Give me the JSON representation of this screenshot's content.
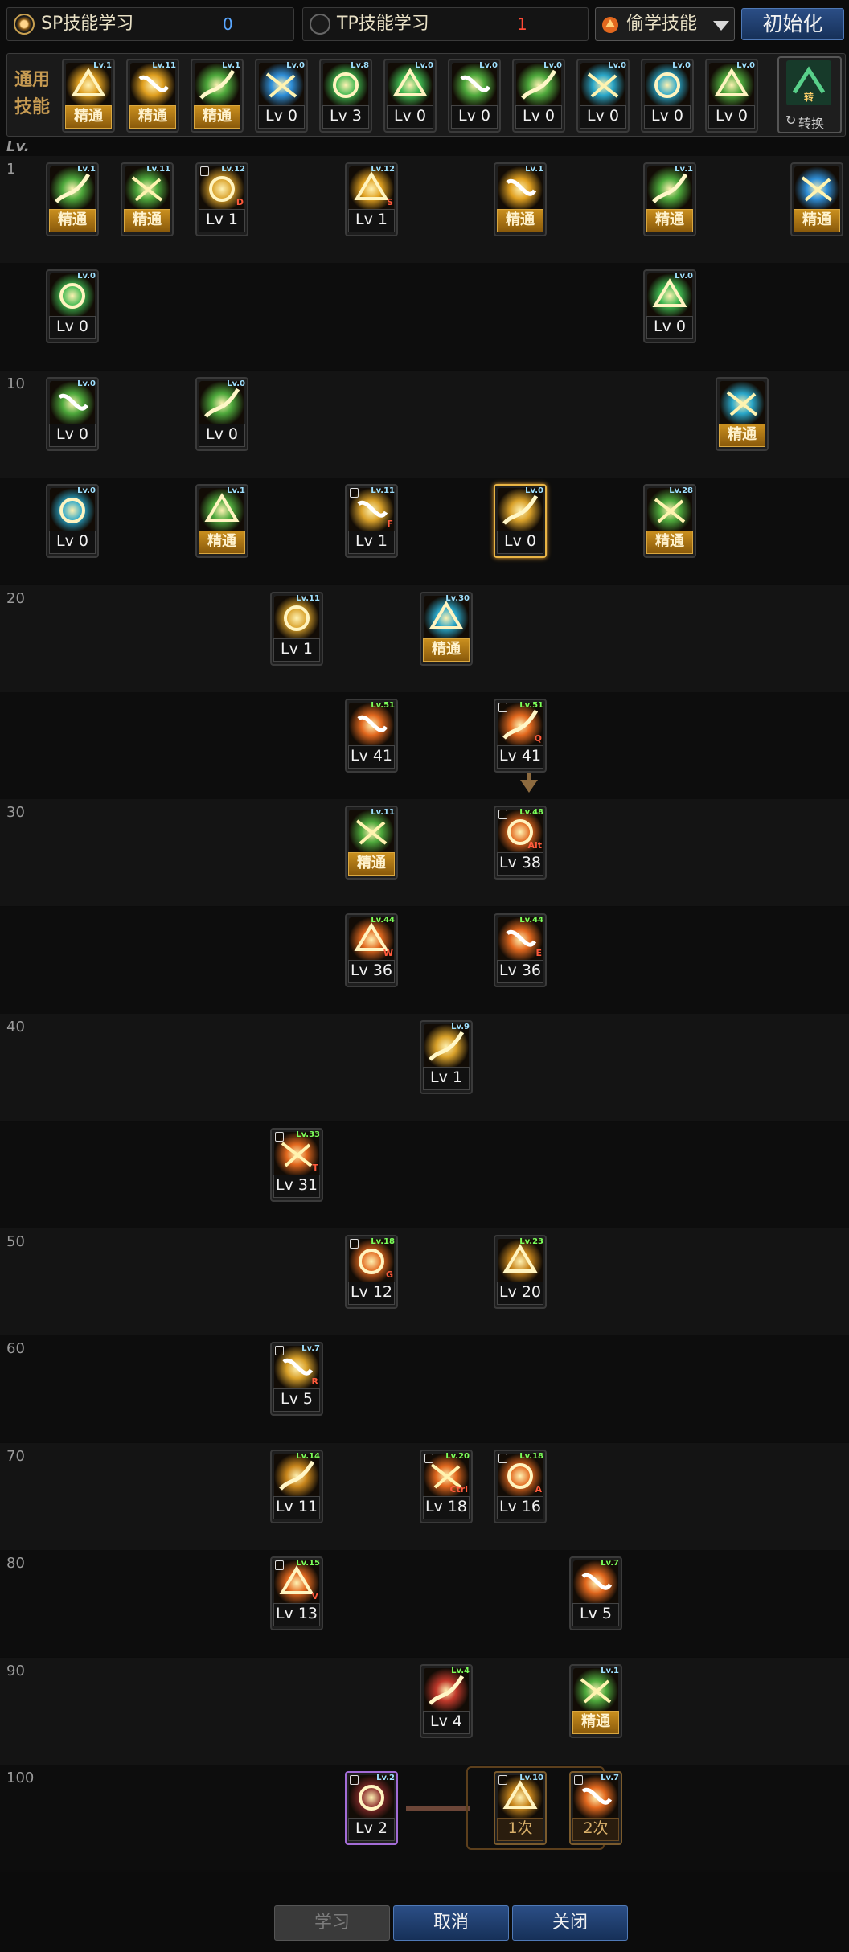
{
  "topbar": {
    "sp_label": "SP技能学习",
    "sp_value": "0",
    "tp_label": "TP技能学习",
    "tp_value": "1",
    "steal_label": "偷学技能",
    "init_label": "初始化"
  },
  "general": {
    "label_line1": "通用",
    "label_line2": "技能",
    "switch_label": "转换",
    "items": [
      {
        "badge": "Lv.1",
        "caption": "精通",
        "master": true,
        "color": "#e0a020"
      },
      {
        "badge": "Lv.11",
        "caption": "精通",
        "master": true,
        "color": "#e0a020"
      },
      {
        "badge": "Lv.1",
        "caption": "精通",
        "master": true,
        "color": "#4ea93c"
      },
      {
        "badge": "Lv.0",
        "caption": "Lv 0",
        "master": false,
        "color": "#2f8fd8"
      },
      {
        "badge": "Lv.8",
        "caption": "Lv 3",
        "master": false,
        "color": "#3fb950"
      },
      {
        "badge": "Lv.0",
        "caption": "Lv 0",
        "master": false,
        "color": "#3fb950"
      },
      {
        "badge": "Lv.0",
        "caption": "Lv 0",
        "master": false,
        "color": "#4ea93c"
      },
      {
        "badge": "Lv.0",
        "caption": "Lv 0",
        "master": false,
        "color": "#4ea93c"
      },
      {
        "badge": "Lv.0",
        "caption": "Lv 0",
        "master": false,
        "color": "#2aa7c9"
      },
      {
        "badge": "Lv.0",
        "caption": "Lv 0",
        "master": false,
        "color": "#2aa7c9"
      },
      {
        "badge": "Lv.0",
        "caption": "Lv 0",
        "master": false,
        "color": "#4ea93c"
      }
    ]
  },
  "lv_header": "Lv.",
  "row_labels": [
    "1",
    "",
    "10",
    "",
    "20",
    "",
    "30",
    "",
    "40",
    "",
    "50",
    "60",
    "70",
    "80",
    "90",
    "100"
  ],
  "skills": [
    {
      "row": 0,
      "col": 0,
      "badge": "Lv.1",
      "caption": "精通",
      "master": true,
      "color": "#4ea93c"
    },
    {
      "row": 0,
      "col": 1,
      "badge": "Lv.11",
      "caption": "精通",
      "master": true,
      "color": "#4ea93c"
    },
    {
      "row": 0,
      "col": 2,
      "badge": "Lv.12",
      "caption": "Lv 1",
      "master": false,
      "color": "#d9a12a",
      "hot": "D",
      "locked": true
    },
    {
      "row": 0,
      "col": 4,
      "badge": "Lv.12",
      "caption": "Lv 1",
      "master": false,
      "color": "#d9a12a",
      "hot": "S"
    },
    {
      "row": 0,
      "col": 6,
      "badge": "Lv.1",
      "caption": "精通",
      "master": true,
      "color": "#4ea93c"
    },
    {
      "row": 0,
      "col": 8,
      "badge": "Lv.1",
      "caption": "精通",
      "master": true,
      "color": "#4ea93c"
    },
    {
      "row": 0,
      "col": 10,
      "badge": "",
      "caption": "精通",
      "master": true,
      "color": "#e2681e"
    },
    {
      "row": 1,
      "col": 0,
      "badge": "Lv.0",
      "caption": "Lv 0",
      "master": false,
      "color": "#d9a12a"
    },
    {
      "row": 1,
      "col": 8,
      "badge": "Lv.0",
      "caption": "Lv 0",
      "master": false,
      "color": "#d9a12a"
    },
    {
      "row": 2,
      "col": 0,
      "badge": "Lv.0",
      "caption": "Lv 0",
      "master": false,
      "color": "#d9a12a"
    },
    {
      "row": 2,
      "col": 2,
      "badge": "Lv.0",
      "caption": "Lv 0",
      "master": false,
      "color": "#2f8fd8"
    },
    {
      "row": 2,
      "col": 9,
      "badge": "",
      "caption": "精通",
      "master": true,
      "color": "#c9861c"
    },
    {
      "row": 3,
      "col": 0,
      "badge": "Lv.0",
      "caption": "Lv 0",
      "master": false,
      "color": "#d9a12a"
    },
    {
      "row": 3,
      "col": 2,
      "badge": "Lv.1",
      "caption": "精通",
      "master": true,
      "color": "#4ea93c"
    },
    {
      "row": 3,
      "col": 4,
      "badge": "Lv.11",
      "caption": "Lv 1",
      "master": false,
      "color": "#d9a12a",
      "hot": "F",
      "locked": true
    },
    {
      "row": 3,
      "col": 6,
      "badge": "Lv.0",
      "caption": "Lv 0",
      "master": false,
      "color": "#d9a12a",
      "selected": true
    },
    {
      "row": 3,
      "col": 8,
      "badge": "Lv.28",
      "caption": "精通",
      "master": true,
      "color": "#4ea93c"
    },
    {
      "row": 4,
      "col": 3,
      "badge": "Lv.11",
      "caption": "Lv 1",
      "master": false,
      "color": "#d9a12a"
    },
    {
      "row": 4,
      "col": 5,
      "badge": "Lv.30",
      "caption": "精通",
      "master": true,
      "color": "#2aa7c9"
    },
    {
      "row": 5,
      "col": 4,
      "badge": "Lv.51",
      "caption": "Lv 41",
      "master": false,
      "color": "#e2681e",
      "red": true
    },
    {
      "row": 5,
      "col": 6,
      "badge": "Lv.51",
      "caption": "Lv 41",
      "master": false,
      "color": "#e2681e",
      "hot": "Q",
      "red": true,
      "locked": true
    },
    {
      "row": 6,
      "col": 4,
      "badge": "Lv.11",
      "caption": "精通",
      "master": true,
      "color": "#4ea93c"
    },
    {
      "row": 6,
      "col": 6,
      "badge": "Lv.48",
      "caption": "Lv 38",
      "master": false,
      "color": "#e2681e",
      "hot": "Alt",
      "red": true,
      "locked": true
    },
    {
      "row": 7,
      "col": 4,
      "badge": "Lv.44",
      "caption": "Lv 36",
      "master": false,
      "color": "#e2681e",
      "hot": "W",
      "red": true
    },
    {
      "row": 7,
      "col": 6,
      "badge": "Lv.44",
      "caption": "Lv 36",
      "master": false,
      "color": "#e2681e",
      "hot": "E",
      "red": true
    },
    {
      "row": 8,
      "col": 5,
      "badge": "Lv.9",
      "caption": "Lv 1",
      "master": false,
      "color": "#d9a12a"
    },
    {
      "row": 9,
      "col": 3,
      "badge": "Lv.33",
      "caption": "Lv 31",
      "master": false,
      "color": "#e2681e",
      "hot": "T",
      "red": true,
      "locked": true
    },
    {
      "row": 10,
      "col": 4,
      "badge": "Lv.18",
      "caption": "Lv 12",
      "master": false,
      "color": "#e2681e",
      "hot": "G",
      "red": true,
      "locked": true
    },
    {
      "row": 10,
      "col": 6,
      "badge": "Lv.23",
      "caption": "Lv 20",
      "master": false,
      "color": "#c9861c",
      "red": true
    },
    {
      "row": 11,
      "col": 3,
      "badge": "Lv.7",
      "caption": "Lv 5",
      "master": false,
      "color": "#d9a12a",
      "hot": "R",
      "locked": true
    },
    {
      "row": 12,
      "col": 3,
      "badge": "Lv.14",
      "caption": "Lv 11",
      "master": false,
      "color": "#c9861c",
      "red": true
    },
    {
      "row": 12,
      "col": 5,
      "badge": "Lv.20",
      "caption": "Lv 18",
      "master": false,
      "color": "#e2681e",
      "hot": "Ctrl",
      "red": true,
      "locked": true
    },
    {
      "row": 12,
      "col": 6,
      "badge": "Lv.18",
      "caption": "Lv 16",
      "master": false,
      "color": "#e2681e",
      "hot": "A",
      "red": true,
      "locked": true
    },
    {
      "row": 13,
      "col": 3,
      "badge": "Lv.15",
      "caption": "Lv 13",
      "master": false,
      "color": "#e2681e",
      "hot": "V",
      "red": true,
      "locked": true
    },
    {
      "row": 13,
      "col": 7,
      "badge": "Lv.7",
      "caption": "Lv 5",
      "master": false,
      "color": "#e2681e",
      "red": true
    },
    {
      "row": 14,
      "col": 5,
      "badge": "Lv.4",
      "caption": "Lv 4",
      "master": false,
      "color": "#c0392b",
      "red": true
    },
    {
      "row": 14,
      "col": 7,
      "badge": "Lv.1",
      "caption": "精通",
      "master": true,
      "color": "#4ea93c"
    },
    {
      "row": 15,
      "col": 4,
      "badge": "Lv.2",
      "caption": "Lv 2",
      "master": false,
      "color": "#8b2b2b",
      "awakening": true,
      "locked": true
    },
    {
      "row": 15,
      "col": 6,
      "badge": "Lv.10",
      "caption": "1次",
      "master": false,
      "color": "#c9861c",
      "stage": true,
      "locked": true
    },
    {
      "row": 15,
      "col": 7,
      "badge": "Lv.7",
      "caption": "2次",
      "master": false,
      "color": "#e2681e",
      "stage": true,
      "locked": true
    }
  ],
  "bottom": {
    "learn_label": "学习",
    "cancel_label": "取消",
    "close_label": "关闭"
  }
}
